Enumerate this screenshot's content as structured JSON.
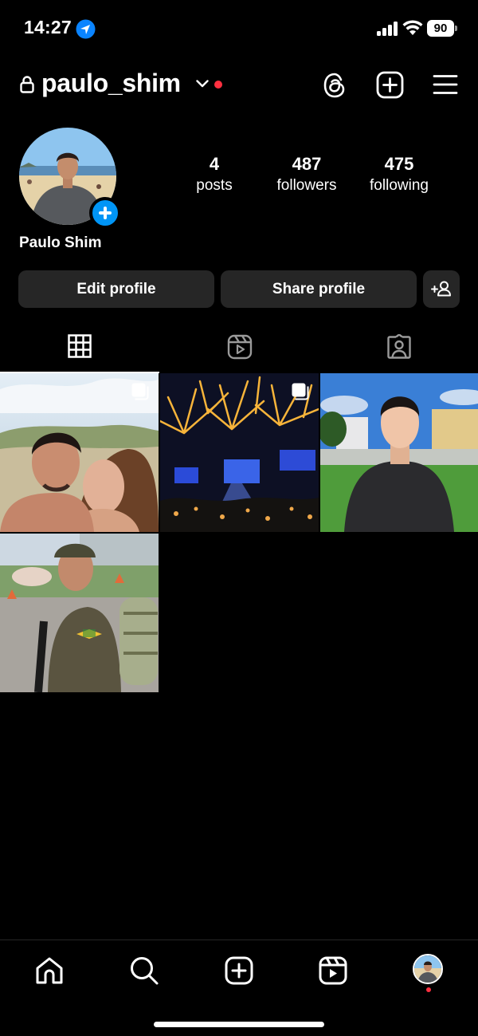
{
  "status_bar": {
    "time": "14:27",
    "battery": "90"
  },
  "header": {
    "username": "paulo_shim"
  },
  "profile": {
    "display_name": "Paulo Shim",
    "stats": [
      {
        "value": "4",
        "label": "posts"
      },
      {
        "value": "487",
        "label": "followers"
      },
      {
        "value": "475",
        "label": "following"
      }
    ]
  },
  "actions": {
    "edit_label": "Edit profile",
    "share_label": "Share profile"
  },
  "tabs": [
    "grid-icon",
    "reels-icon",
    "tagged-icon"
  ],
  "posts": [
    {
      "kind": "carousel",
      "subject": "couple-selfie"
    },
    {
      "kind": "carousel",
      "subject": "concert"
    },
    {
      "kind": "single",
      "subject": "portrait-garden"
    },
    {
      "kind": "single",
      "subject": "soldier"
    }
  ],
  "nav": [
    "home-icon",
    "search-icon",
    "create-icon",
    "reels-icon",
    "profile-avatar"
  ],
  "colors": {
    "background": "#000000",
    "button": "#262626",
    "accent_blue": "#0095f6",
    "notification_red": "#ff3040"
  }
}
